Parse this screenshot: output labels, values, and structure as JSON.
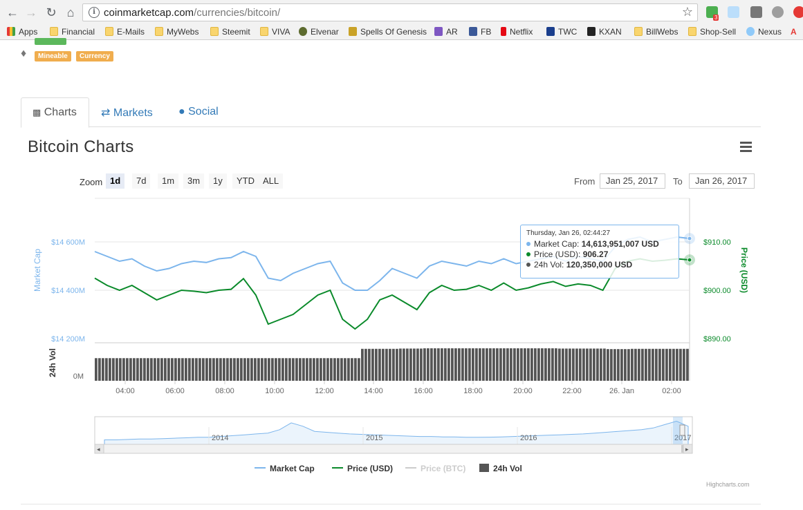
{
  "browser": {
    "url_host": "coinmarketcap.com",
    "url_path": "/currencies/bitcoin/",
    "extension_badge": "3",
    "bookmarks": [
      "Apps",
      "Financial",
      "E-Mails",
      "MyWebs",
      "Steemit",
      "VIVA",
      "Elvenar",
      "Spells Of Genesis",
      "AR",
      "FB",
      "Netflix",
      "TWC",
      "KXAN",
      "BillWebs",
      "Shop-Sell",
      "Nexus"
    ]
  },
  "labels": {
    "mineable": "Mineable",
    "currency": "Currency"
  },
  "tabs": [
    "Charts",
    "Markets",
    "Social"
  ],
  "chart_title": "Bitcoin Charts",
  "zoom": {
    "label": "Zoom",
    "buttons": [
      "1d",
      "7d",
      "1m",
      "3m",
      "1y",
      "YTD",
      "ALL"
    ],
    "selected": "1d"
  },
  "range": {
    "from_label": "From",
    "from_value": "Jan 25, 2017",
    "to_label": "To",
    "to_value": "Jan 26, 2017"
  },
  "tooltip": {
    "date": "Thursday, Jan 26, 02:44:27",
    "market_cap_label": "Market Cap:",
    "market_cap_value": "14,613,951,007 USD",
    "price_label": "Price (USD):",
    "price_value": "906.27",
    "vol_label": "24h Vol:",
    "vol_value": "120,350,000 USD"
  },
  "legend": [
    "Market Cap",
    "Price (USD)",
    "Price (BTC)",
    "24h Vol"
  ],
  "credits": "Highcharts.com",
  "colors": {
    "market_cap": "#7cb5ec",
    "price_usd": "#0a8a2a",
    "volume": "#555555",
    "label": "#f0ad4e",
    "link": "#337ab7"
  },
  "chart_data": {
    "type": "line",
    "x": [
      "03:00",
      "03:30",
      "04:00",
      "04:30",
      "05:00",
      "05:30",
      "06:00",
      "06:30",
      "07:00",
      "07:30",
      "08:00",
      "08:30",
      "09:00",
      "09:30",
      "10:00",
      "10:30",
      "11:00",
      "11:30",
      "12:00",
      "12:30",
      "13:00",
      "13:30",
      "14:00",
      "14:30",
      "15:00",
      "15:30",
      "16:00",
      "16:30",
      "17:00",
      "17:30",
      "18:00",
      "18:30",
      "19:00",
      "19:30",
      "20:00",
      "20:30",
      "21:00",
      "21:30",
      "22:00",
      "22:30",
      "23:00",
      "23:30",
      "00:00",
      "00:30",
      "01:00",
      "01:30",
      "02:00",
      "02:30",
      "02:44"
    ],
    "x_ticks": [
      "04:00",
      "06:00",
      "08:00",
      "10:00",
      "12:00",
      "14:00",
      "16:00",
      "18:00",
      "20:00",
      "22:00",
      "26. Jan",
      "02:00"
    ],
    "series": [
      {
        "name": "Market Cap",
        "axis": "left",
        "values": [
          14560,
          14540,
          14520,
          14530,
          14500,
          14480,
          14490,
          14510,
          14520,
          14515,
          14530,
          14535,
          14560,
          14540,
          14450,
          14440,
          14470,
          14490,
          14510,
          14520,
          14430,
          14400,
          14400,
          14440,
          14490,
          14470,
          14450,
          14500,
          14520,
          14510,
          14500,
          14520,
          14510,
          14530,
          14510,
          14520,
          14530,
          14540,
          14520,
          14540,
          14530,
          14520,
          14580,
          14610,
          14620,
          14600,
          14610,
          14620,
          14614
        ]
      },
      {
        "name": "Price (USD)",
        "axis": "right",
        "values": [
          902.5,
          901,
          900,
          901,
          899.5,
          898,
          899,
          900,
          899.8,
          899.5,
          900,
          900.2,
          902.4,
          899,
          893,
          894,
          895,
          897,
          899,
          900,
          894,
          892,
          894,
          898,
          899,
          897.5,
          896,
          899.5,
          901,
          900,
          900.2,
          901,
          900,
          901.5,
          900,
          900.5,
          901.3,
          901.8,
          900.8,
          901.3,
          901,
          900,
          904.5,
          906,
          906.5,
          906,
          906.2,
          906.5,
          906.27
        ]
      },
      {
        "name": "24h Vol",
        "axis": "volume",
        "values": [
          85,
          85,
          85,
          85,
          85,
          85,
          85,
          85,
          85,
          85,
          85,
          85,
          85,
          85,
          85,
          85,
          85,
          85,
          85,
          85,
          85,
          85,
          120,
          120,
          120,
          121,
          121,
          122,
          122,
          122,
          122,
          122,
          122,
          122,
          122,
          122,
          122,
          122,
          121,
          121,
          121,
          121,
          119,
          119,
          120,
          120,
          120,
          120,
          120
        ]
      }
    ],
    "left_axis": {
      "title": "Market Cap",
      "ticks": [
        "$14 200M",
        "$14 400M",
        "$14 600M"
      ],
      "range": [
        14200,
        14600
      ]
    },
    "right_axis": {
      "title": "Price (USD)",
      "ticks": [
        "$890.00",
        "$900.00",
        "$910.00"
      ],
      "range": [
        890,
        910
      ]
    },
    "volume_axis": {
      "title": "24h Vol",
      "ticks": [
        "0M"
      ]
    },
    "navigator": {
      "ticks": [
        "2014",
        "2015",
        "2016",
        "2017"
      ],
      "values": [
        2,
        2,
        2.5,
        3,
        3,
        3.5,
        4,
        4.5,
        5,
        5,
        6,
        7,
        8,
        9,
        10,
        14,
        22,
        18,
        12,
        11,
        10,
        9,
        8.5,
        8,
        7.5,
        7,
        6.5,
        6,
        6,
        5.5,
        5.5,
        5,
        5,
        5.2,
        5.5,
        6,
        6.5,
        7,
        7.5,
        8,
        8.5,
        9,
        10,
        11,
        12,
        13,
        14,
        16,
        20,
        24,
        18
      ]
    },
    "legend_position": "bottom-center"
  }
}
